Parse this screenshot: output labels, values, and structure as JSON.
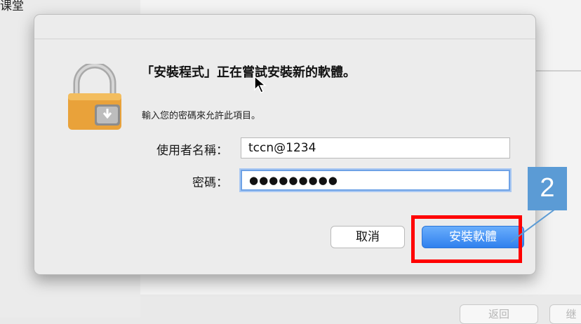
{
  "background": {
    "fragment_text": "课堂",
    "back_button_label": "返回",
    "next_button_label": "继"
  },
  "dialog": {
    "heading": "「安裝程式」正在嘗試安裝新的軟體。",
    "subtext": "輸入您的密碼來允許此項目。",
    "username_label": "使用者名稱：",
    "username_value": "tccn@1234",
    "password_label": "密碼：",
    "password_value": "●●●●●●●●●",
    "cancel_label": "取消",
    "install_label": "安裝軟體"
  },
  "annotation": {
    "step_number": "2",
    "highlight_color": "#ff0000",
    "badge_color": "#5b9bd5"
  },
  "icons": {
    "dialog_icon": "lock-installer-icon",
    "pointer": "mouse-cursor-icon"
  }
}
